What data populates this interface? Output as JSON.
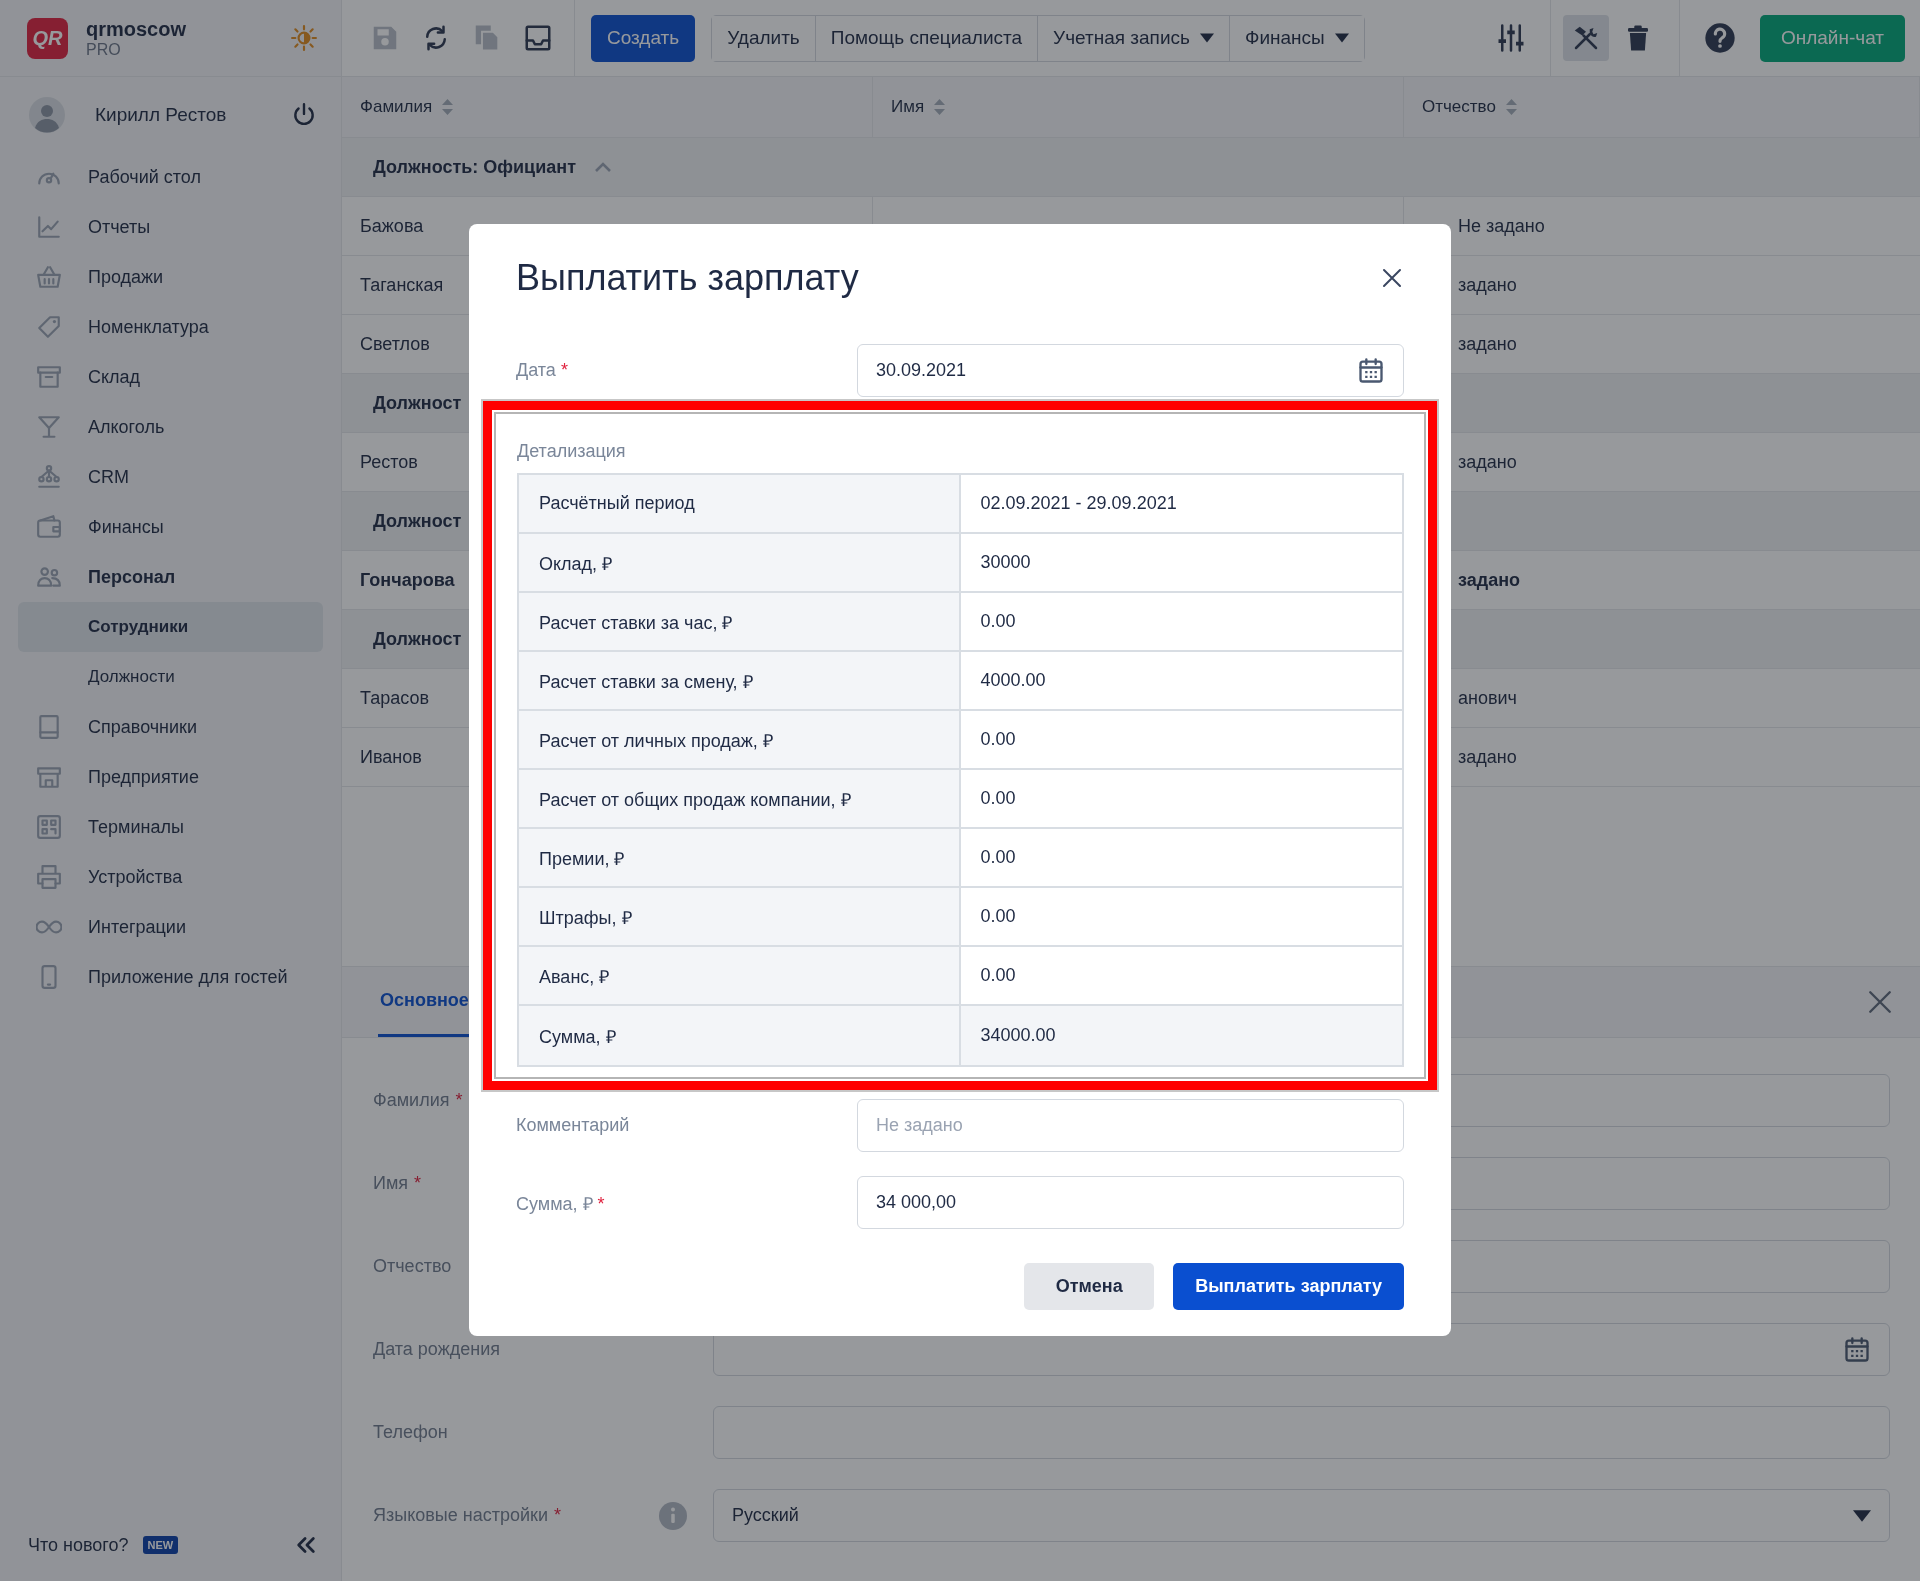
{
  "app": {
    "logo_text": "QR",
    "name": "qrmoscow",
    "plan": "PRO"
  },
  "user": {
    "name": "Кирилл Рестов"
  },
  "sidebar": {
    "items": [
      {
        "label": "Рабочий стол",
        "selected": false
      },
      {
        "label": "Отчеты",
        "selected": false
      },
      {
        "label": "Продажи",
        "selected": false
      },
      {
        "label": "Номенклатура",
        "selected": false
      },
      {
        "label": "Склад",
        "selected": false
      },
      {
        "label": "Алкоголь",
        "selected": false
      },
      {
        "label": "CRM",
        "selected": false
      },
      {
        "label": "Финансы",
        "selected": false
      },
      {
        "label": "Персонал",
        "selected": false,
        "expanded": true,
        "children": [
          {
            "label": "Сотрудники",
            "selected": true
          },
          {
            "label": "Должности",
            "selected": false
          }
        ]
      },
      {
        "label": "Справочники",
        "selected": false
      },
      {
        "label": "Предприятие",
        "selected": false
      },
      {
        "label": "Терминалы",
        "selected": false
      },
      {
        "label": "Устройства",
        "selected": false
      },
      {
        "label": "Интеграции",
        "selected": false
      },
      {
        "label": "Приложение для гостей",
        "selected": false
      }
    ],
    "whats_new": "Что нового?",
    "new_badge": "NEW"
  },
  "toolbar": {
    "icons": [
      {
        "kind": "save",
        "disabled": true
      },
      {
        "kind": "refresh",
        "disabled": false
      },
      {
        "kind": "copy",
        "disabled": true
      },
      {
        "kind": "inbox",
        "disabled": false
      }
    ],
    "create": "Создать",
    "buttons": [
      {
        "label": "Удалить",
        "has_menu": false
      },
      {
        "label": "Помощь специалиста",
        "has_menu": false
      },
      {
        "label": "Учетная запись",
        "has_menu": true
      },
      {
        "label": "Финансы",
        "has_menu": true
      }
    ],
    "tools": [
      {
        "kind": "sliders",
        "selected": false
      },
      {
        "kind": "tools",
        "selected": true
      },
      {
        "kind": "trash",
        "selected": false
      }
    ],
    "chat": "Онлайн-чат"
  },
  "table": {
    "columns": [
      {
        "label": "Фамилия"
      },
      {
        "label": "Имя"
      },
      {
        "label": "Отчество"
      }
    ],
    "rows": [
      {
        "kind": "group",
        "label": "Должность: Официант",
        "expanded": true
      },
      {
        "kind": "row",
        "surname": "Бажова",
        "patronymic": "Не задано",
        "emphasized": false
      },
      {
        "kind": "row",
        "surname": "Таганская",
        "patronymic": "задано",
        "emphasized": false
      },
      {
        "kind": "row",
        "surname": "Светлов",
        "patronymic": "задано",
        "emphasized": false
      },
      {
        "kind": "group",
        "label": "Должност"
      },
      {
        "kind": "row",
        "surname": "Рестов",
        "patronymic": "задано",
        "emphasized": false
      },
      {
        "kind": "group",
        "label": "Должност"
      },
      {
        "kind": "row",
        "surname": "Гончарова",
        "patronymic": "задано",
        "emphasized": true
      },
      {
        "kind": "group",
        "label": "Должност"
      },
      {
        "kind": "row",
        "surname": "Тарасов",
        "patronymic": "анович",
        "emphasized": false
      },
      {
        "kind": "row",
        "surname": "Иванов",
        "patronymic": "задано",
        "emphasized": false
      }
    ]
  },
  "panel": {
    "tabs": [
      {
        "label": "Основное",
        "selected": true
      }
    ],
    "fields": [
      {
        "label": "Фамилия",
        "required_mark": "*",
        "kind": "text"
      },
      {
        "label": "Имя",
        "required_mark": "*",
        "kind": "text"
      },
      {
        "label": "Отчество",
        "kind": "text"
      },
      {
        "label": "Дата рождения",
        "kind": "date"
      },
      {
        "label": "Телефон",
        "kind": "text"
      },
      {
        "label": "Языковые настройки",
        "required_mark": "*",
        "kind": "select",
        "info": true,
        "value": "Русский"
      }
    ]
  },
  "modal": {
    "title": "Выплатить зарплату",
    "date": {
      "label": "Дата",
      "required_mark": "*",
      "value": "30.09.2021"
    },
    "details": {
      "label": "Детализация",
      "highlighted": true,
      "rows": [
        {
          "name": "Расчётный период",
          "value": "02.09.2021 - 29.09.2021",
          "kind": "item"
        },
        {
          "name": "Оклад, ₽",
          "value": "30000",
          "kind": "item"
        },
        {
          "name": "Расчет ставки за час, ₽",
          "value": "0.00",
          "kind": "item"
        },
        {
          "name": "Расчет ставки за смену, ₽",
          "value": "4000.00",
          "kind": "item"
        },
        {
          "name": "Расчет от личных продаж, ₽",
          "value": "0.00",
          "kind": "item"
        },
        {
          "name": "Расчет от общих продаж компании, ₽",
          "value": "0.00",
          "kind": "item"
        },
        {
          "name": "Премии, ₽",
          "value": "0.00",
          "kind": "item"
        },
        {
          "name": "Штрафы, ₽",
          "value": "0.00",
          "kind": "item"
        },
        {
          "name": "Аванс, ₽",
          "value": "0.00",
          "kind": "item"
        },
        {
          "name": "Сумма, ₽",
          "value": "34000.00",
          "kind": "total"
        }
      ]
    },
    "comment": {
      "label": "Комментарий",
      "placeholder": "Не задано"
    },
    "amount": {
      "label": "Сумма, ₽",
      "required_mark": "*",
      "value": "34 000,00"
    },
    "cancel": "Отмена",
    "submit": "Выплатить зарплату"
  }
}
